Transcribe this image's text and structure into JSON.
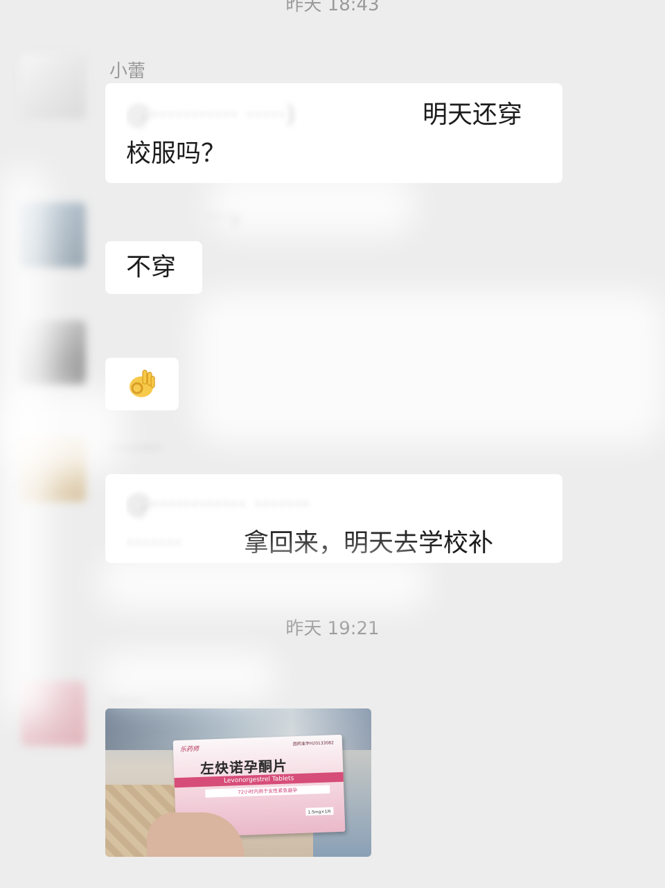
{
  "timestamps": {
    "top": "昨天 18:43",
    "middle": "昨天 19:21"
  },
  "messages": [
    {
      "sender": "小蕾",
      "text_visible": "明天还穿",
      "text_line2": "校服吗？"
    },
    {
      "text": "不穿"
    },
    {
      "emoji_icon": "ok-hand-icon"
    },
    {
      "text_visible": "拿回来，明天去学校补"
    }
  ],
  "photo": {
    "brand": "乐药师",
    "registration": "国药准字H20133082",
    "product_name": "左炔诺孕酮片",
    "latin_name": "Levonorgestrel Tablets",
    "note": "72小时内用于女性紧急避孕",
    "dosage": "1.5mg×1片"
  },
  "colors": {
    "background": "#ededed",
    "bubble": "#ffffff",
    "timestamp_text": "#9a9a9a",
    "box_pink": "#d64d79"
  }
}
